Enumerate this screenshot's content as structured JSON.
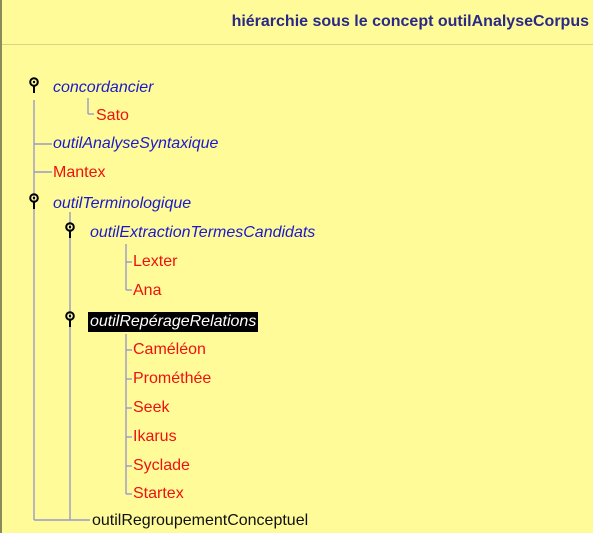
{
  "header": {
    "title": "hiérarchie sous le concept outilAnalyseCorpus"
  },
  "tree": {
    "concordancier": "concordancier",
    "sato": "Sato",
    "outilAnalyseSyntaxique": "outilAnalyseSyntaxique",
    "mantex": "Mantex",
    "outilTerminologique": "outilTerminologique",
    "outilExtractionTermesCandidats": "outilExtractionTermesCandidats",
    "lexter": "Lexter",
    "ana": "Ana",
    "outilReperageRelations": "outilRepérageRelations",
    "cameleon": "Caméléon",
    "promethee": "Prométhée",
    "seek": "Seek",
    "ikarus": "Ikarus",
    "syclade": "Syclade",
    "startex": "Startex",
    "outilRegroupementConceptuel": "outilRegroupementConceptuel"
  },
  "colors": {
    "background": "#fffb99",
    "concept": "#1a1acc",
    "instance": "#ee1111",
    "lines": "#9a9ac8",
    "header": "#2a2a86"
  },
  "icons": {
    "expanded_toggle": "key-toggle-icon"
  }
}
